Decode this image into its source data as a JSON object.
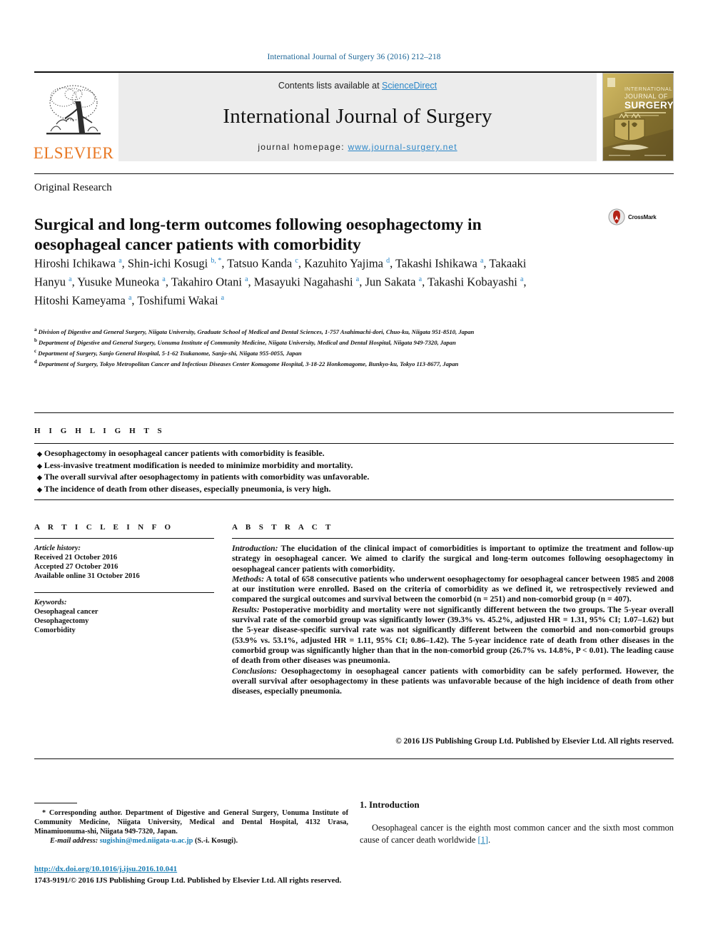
{
  "running_head": "International Journal of Surgery 36 (2016) 212–218",
  "masthead": {
    "contents_prefix": "Contents lists available at ",
    "sciencedirect": "ScienceDirect",
    "journal_title": "International Journal of Surgery",
    "homepage_label": "journal homepage:",
    "homepage_url": "www.journal-surgery.net",
    "publisher": "ELSEVIER",
    "cover_lines": [
      "INTERNATIONAL",
      "JOURNAL OF",
      "SURGERY"
    ],
    "link_color": "#2a86c8",
    "publisher_color": "#E87722"
  },
  "article": {
    "type": "Original Research",
    "title": "Surgical and long-term outcomes following oesophagectomy in oesophageal cancer patients with comorbidity",
    "crossmark_label": "CrossMark",
    "authors_html": "Hiroshi Ichikawa <sup>a</sup>, Shin-ichi Kosugi <sup>b, *</sup>, Tatsuo Kanda <sup>c</sup>, Kazuhito Yajima <sup>d</sup>, Takashi Ishikawa <sup>a</sup>, Takaaki Hanyu <sup>a</sup>, Yusuke Muneoka <sup>a</sup>, Takahiro Otani <sup>a</sup>, Masayuki Nagahashi <sup>a</sup>, Jun Sakata <sup>a</sup>, Takashi Kobayashi <sup>a</sup>, Hitoshi Kameyama <sup>a</sup>, Toshifumi Wakai <sup>a</sup>",
    "affiliations": [
      {
        "marker": "a",
        "text": "Division of Digestive and General Surgery, Niigata University, Graduate School of Medical and Dental Sciences, 1-757 Asahimachi-dori, Chuo-ku, Niigata 951-8510, Japan"
      },
      {
        "marker": "b",
        "text": "Department of Digestive and General Surgery, Uonuma Institute of Community Medicine, Niigata University, Medical and Dental Hospital, Niigata 949-7320, Japan"
      },
      {
        "marker": "c",
        "text": "Department of Surgery, Sanjo General Hospital, 5-1-62 Tsukanome, Sanjo-shi, Niigata 955-0055, Japan"
      },
      {
        "marker": "d",
        "text": "Department of Surgery, Tokyo Metropolitan Cancer and Infectious Diseases Center Komagome Hospital, 3-18-22 Honkomagome, Bunkyo-ku, Tokyo 113-8677, Japan"
      }
    ]
  },
  "highlights": {
    "heading": "H I G H L I G H T S",
    "items": [
      "Oesophagectomy in oesophageal cancer patients with comorbidity is feasible.",
      "Less-invasive treatment modification is needed to minimize morbidity and mortality.",
      "The overall survival after oesophagectomy in patients with comorbidity was unfavorable.",
      "The incidence of death from other diseases, especially pneumonia, is very high."
    ]
  },
  "article_info": {
    "heading": "A R T I C L E  I N F O",
    "history_label": "Article history:",
    "history": [
      "Received 21 October 2016",
      "Accepted 27 October 2016",
      "Available online 31 October 2016"
    ],
    "keywords_label": "Keywords:",
    "keywords": [
      "Oesophageal cancer",
      "Oesophagectomy",
      "Comorbidity"
    ]
  },
  "abstract": {
    "heading": "A B S T R A C T",
    "sections": [
      {
        "label": "Introduction:",
        "text": " The elucidation of the clinical impact of comorbidities is important to optimize the treatment and follow-up strategy in oesophageal cancer. We aimed to clarify the surgical and long-term outcomes following oesophagectomy in oesophageal cancer patients with comorbidity."
      },
      {
        "label": "Methods:",
        "text": " A total of 658 consecutive patients who underwent oesophagectomy for oesophageal cancer between 1985 and 2008 at our institution were enrolled. Based on the criteria of comorbidity as we defined it, we retrospectively reviewed and compared the surgical outcomes and survival between the comorbid (n = 251) and non-comorbid group (n = 407)."
      },
      {
        "label": "Results:",
        "text": " Postoperative morbidity and mortality were not significantly different between the two groups. The 5-year overall survival rate of the comorbid group was significantly lower (39.3% vs. 45.2%, adjusted HR = 1.31, 95% CI; 1.07–1.62) but the 5-year disease-specific survival rate was not significantly different between the comorbid and non-comorbid groups (53.9% vs. 53.1%, adjusted HR = 1.11, 95% CI; 0.86–1.42). The 5-year incidence rate of death from other diseases in the comorbid group was significantly higher than that in the non-comorbid group (26.7% vs. 14.8%, P < 0.01). The leading cause of death from other diseases was pneumonia."
      },
      {
        "label": "Conclusions:",
        "text": " Oesophagectomy in oesophageal cancer patients with comorbidity can be safely performed. However, the overall survival after oesophagectomy in these patients was unfavorable because of the high incidence of death from other diseases, especially pneumonia."
      }
    ],
    "copyright": "© 2016 IJS Publishing Group Ltd. Published by Elsevier Ltd. All rights reserved."
  },
  "footnote": {
    "corresponding": "Corresponding author. Department of Digestive and General Surgery, Uonuma Institute of Community Medicine, Niigata University, Medical and Dental Hospital, 4132 Urasa, Minamiuonuma-shi, Niigata 949-7320, Japan.",
    "email_label": "E-mail address:",
    "email": "sugishin@med.niigata-u.ac.jp",
    "email_suffix": " (S.-i. Kosugi)."
  },
  "introduction": {
    "heading": "1. Introduction",
    "paragraph_prefix": "Oesophageal cancer is the eighth most common cancer and the sixth most common cause of cancer death worldwide ",
    "ref": "[1]",
    "paragraph_suffix": "."
  },
  "bottom": {
    "doi": "http://dx.doi.org/10.1016/j.ijsu.2016.10.041",
    "issn_line": "1743-9191/© 2016 IJS Publishing Group Ltd. Published by Elsevier Ltd. All rights reserved."
  }
}
